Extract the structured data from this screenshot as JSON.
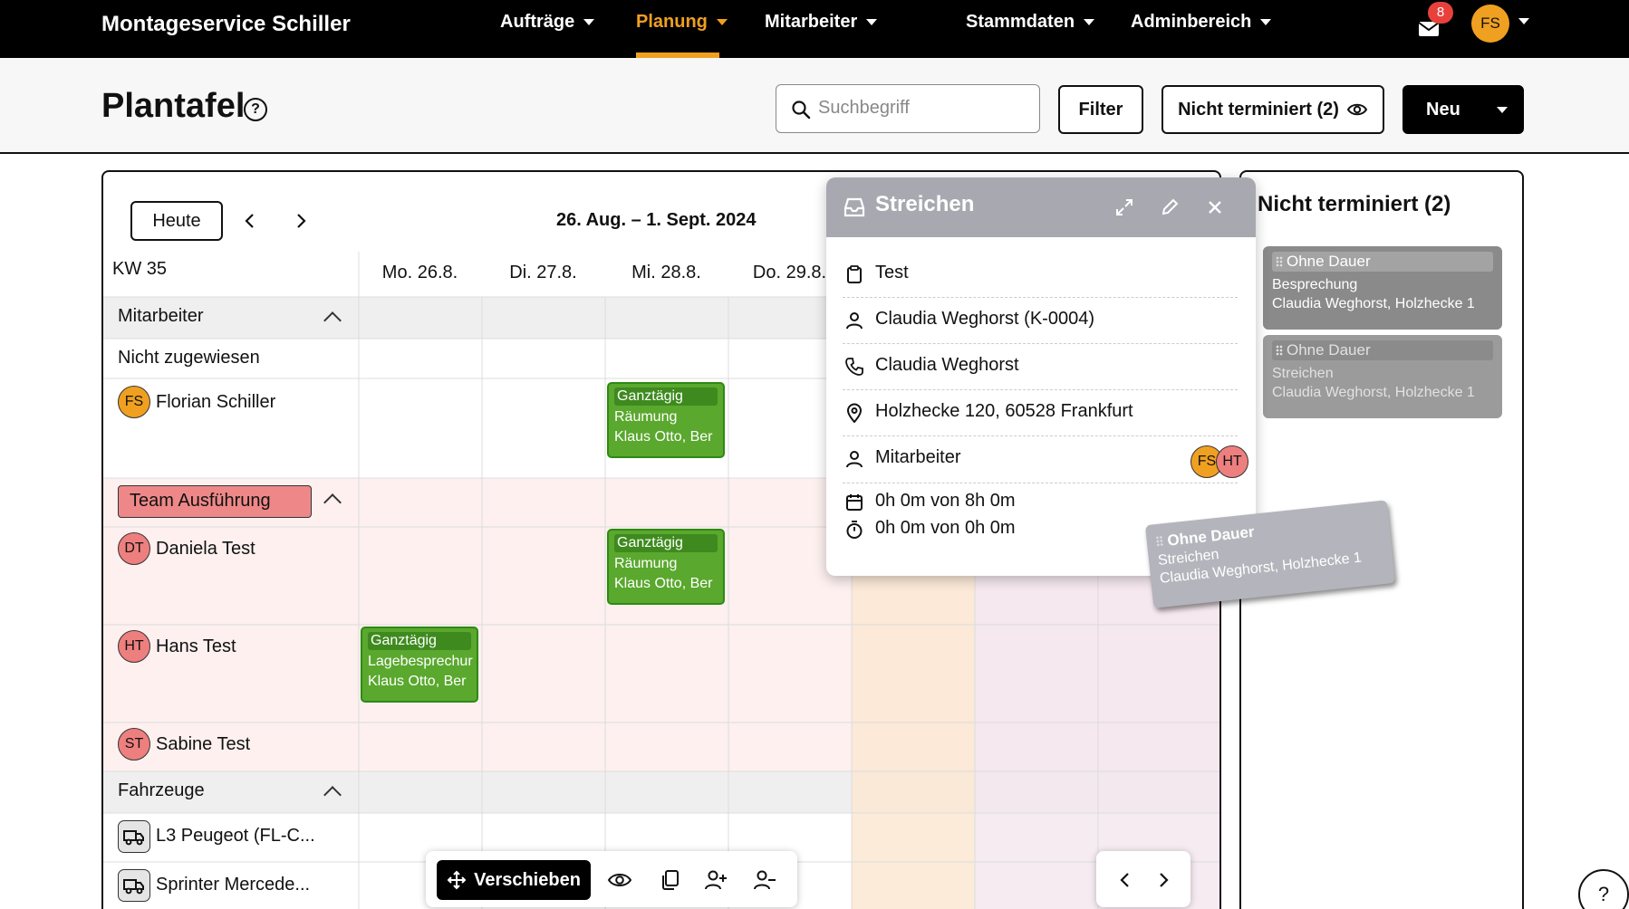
{
  "app": {
    "brand": "Montageservice Schiller"
  },
  "nav": {
    "items": [
      {
        "label": "Aufträge"
      },
      {
        "label": "Planung"
      },
      {
        "label": "Mitarbeiter"
      },
      {
        "label": "Stammdaten"
      },
      {
        "label": "Adminbereich"
      }
    ],
    "active": "Planung",
    "mail_badge": "8",
    "user_initials": "FS",
    "accent_color": "#f0a020"
  },
  "header": {
    "title": "Plantafel",
    "search_placeholder": "Suchbegriff",
    "filter_label": "Filter",
    "unscheduled_label": "Nicht terminiert (2)",
    "new_label": "Neu"
  },
  "calendar": {
    "today_label": "Heute",
    "date_range": "26. Aug. – 1. Sept. 2024",
    "week_label": "KW 35",
    "days": [
      "Mo. 26.8.",
      "Di. 27.8.",
      "Mi. 28.8.",
      "Do. 29.8."
    ],
    "groups": {
      "employees": "Mitarbeiter",
      "team": "Team Ausführung",
      "vehicles": "Fahrzeuge"
    },
    "unassigned": "Nicht zugewiesen",
    "people": [
      {
        "initials": "FS",
        "name": "Florian Schiller"
      },
      {
        "initials": "DT",
        "name": "Daniela Test"
      },
      {
        "initials": "HT",
        "name": "Hans Test"
      },
      {
        "initials": "ST",
        "name": "Sabine Test"
      }
    ],
    "vehicles": [
      {
        "name": "L3 Peugeot (FL-C..."
      },
      {
        "name": "Sprinter Mercede..."
      }
    ],
    "events": [
      {
        "top": "Ganztägig",
        "title": "Räumung",
        "who": "Klaus Otto, Ber"
      },
      {
        "top": "Ganztägig",
        "title": "Räumung",
        "who": "Klaus Otto, Ber"
      },
      {
        "top": "Ganztägig",
        "title": "Lagebesprechur",
        "who": "Klaus Otto, Ber"
      }
    ],
    "event_color": "#5aa82e"
  },
  "toolbar": {
    "move_label": "Verschieben"
  },
  "popup": {
    "title": "Streichen",
    "description": "Test",
    "customer": "Claudia Weghorst (K-0004)",
    "contact": "Claudia Weghorst",
    "address": "Holzhecke 120, 60528 Frankfurt",
    "staff_label": "Mitarbeiter",
    "staff": [
      "FS",
      "HT"
    ],
    "duration": "0h 0m von 8h 0m",
    "timer": "0h 0m von 0h 0m",
    "header_color": "#a8a8b0"
  },
  "sidebar": {
    "title": "Nicht terminiert (2)",
    "cards": [
      {
        "top": "Ohne Dauer",
        "title": "Besprechung",
        "who": "Claudia Weghorst, Holzhecke 1"
      },
      {
        "top": "Ohne Dauer",
        "title": "Streichen",
        "who": "Claudia Weghorst, Holzhecke 1"
      }
    ]
  },
  "drag_card": {
    "top": "Ohne Dauer",
    "title": "Streichen",
    "who": "Claudia Weghorst, Holzhecke 1"
  },
  "help_fab": "?"
}
